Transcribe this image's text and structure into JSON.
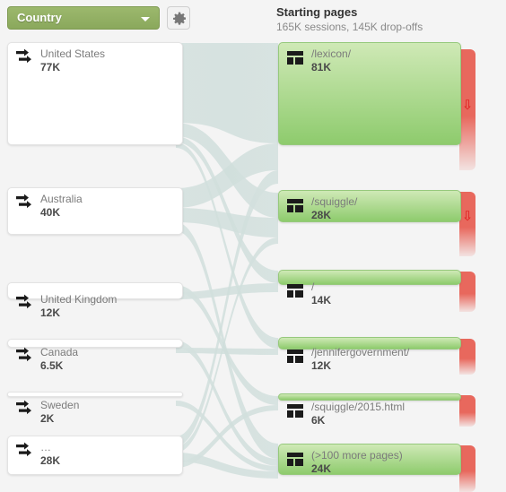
{
  "toolbar": {
    "dimension_label": "Country",
    "dimension_icon": "chevron-down-icon",
    "settings_icon": "gear-icon"
  },
  "column_header": {
    "title": "Starting pages",
    "subtitle": "165K sessions, 145K drop-offs"
  },
  "colors": {
    "background": "#f4f4f4",
    "dimension_button": "#8aa85c",
    "node_green_top": "#cfe9b6",
    "node_green_bottom": "#8ecb6d",
    "dropoff_red": "#e8685d",
    "ribbon": "#d3e0de",
    "label_text": "#7b7b7b",
    "value_text": "#4a4a4a"
  },
  "chart_data": {
    "type": "sankey",
    "title": "Starting pages",
    "subtitle": "165K sessions, 145K drop-offs",
    "total_sessions": "165K",
    "total_dropoffs": "145K",
    "columns": [
      {
        "name": "Country",
        "node_icon": "arrows-right-icon",
        "nodes": [
          {
            "label": "United States",
            "value": "77K",
            "value_num": 77000
          },
          {
            "label": "Australia",
            "value": "40K",
            "value_num": 40000
          },
          {
            "label": "United Kingdom",
            "value": "12K",
            "value_num": 12000
          },
          {
            "label": "Canada",
            "value": "6.5K",
            "value_num": 6500
          },
          {
            "label": "Sweden",
            "value": "2K",
            "value_num": 2000
          },
          {
            "label": "…",
            "value": "28K",
            "value_num": 28000
          }
        ]
      },
      {
        "name": "Starting pages",
        "node_icon": "page-layout-icon",
        "nodes": [
          {
            "label": "/lexicon/",
            "value": "81K",
            "value_num": 81000,
            "dropoff_arrow": true
          },
          {
            "label": "/squiggle/",
            "value": "28K",
            "value_num": 28000,
            "dropoff_arrow": true
          },
          {
            "label": "/",
            "value": "14K",
            "value_num": 14000,
            "dropoff_arrow": false
          },
          {
            "label": "/jennifergovernment/",
            "value": "12K",
            "value_num": 12000,
            "dropoff_arrow": false
          },
          {
            "label": "/squiggle/2015.html",
            "value": "6K",
            "value_num": 6000,
            "dropoff_arrow": false
          },
          {
            "label": "(>100 more pages)",
            "value": "24K",
            "value_num": 24000,
            "dropoff_arrow": false
          }
        ]
      }
    ]
  }
}
